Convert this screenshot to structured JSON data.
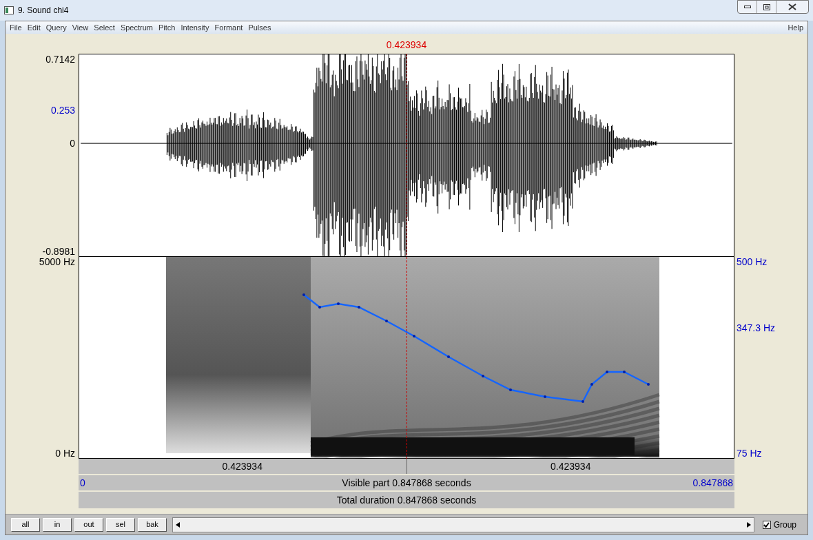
{
  "window": {
    "title": "9. Sound chi4"
  },
  "menu": {
    "items": [
      "File",
      "Edit",
      "Query",
      "View",
      "Select",
      "Spectrum",
      "Pitch",
      "Intensity",
      "Formant",
      "Pulses"
    ],
    "help": "Help"
  },
  "cursor_time": "0.423934",
  "waveform": {
    "labels": [
      {
        "text": "0.7142",
        "color": "#000000"
      },
      {
        "text": "0.253",
        "color": "#0000cc"
      },
      {
        "text": "0",
        "color": "#000000"
      },
      {
        "text": "-0.8981",
        "color": "#000000"
      }
    ]
  },
  "spectrogram": {
    "left_labels": [
      "5000 Hz",
      "0 Hz"
    ],
    "right_labels": [
      {
        "text": "500 Hz",
        "color": "#0000cc"
      },
      {
        "text": "347.3 Hz",
        "color": "#0000cc"
      },
      {
        "text": "75 Hz",
        "color": "#0000cc"
      }
    ]
  },
  "time_bars": {
    "left_half": "0.423934",
    "right_half": "0.423934",
    "start": "0",
    "visible": "Visible part 0.847868 seconds",
    "end": "0.847868",
    "total": "Total duration 0.847868 seconds"
  },
  "buttons": [
    "all",
    "in",
    "out",
    "sel",
    "bak"
  ],
  "group": {
    "label": "Group",
    "checked": true
  }
}
